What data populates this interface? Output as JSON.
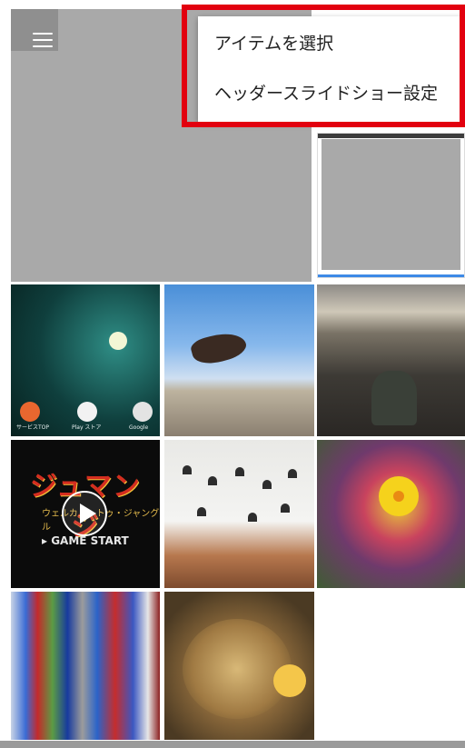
{
  "menu": {
    "items": [
      "アイテムを選択",
      "ヘッダースライドショー設定"
    ]
  },
  "tiles": {
    "android_home": {
      "apps": [
        "サービスTOP",
        "Play ストア",
        "Google"
      ]
    },
    "game": {
      "title": "ジュマンジ",
      "subtitle": "ウェルカム・トゥ・ジャングル",
      "start": "▸ GAME START"
    }
  },
  "colors": {
    "highlight_border": "#e2000f",
    "menu_background": "#ffffff",
    "placeholder_gray": "#a9a9a9",
    "accent_blue": "#3e8ae6"
  },
  "icons": {
    "menu": "hamburger-menu-icon",
    "play": "play-icon"
  }
}
